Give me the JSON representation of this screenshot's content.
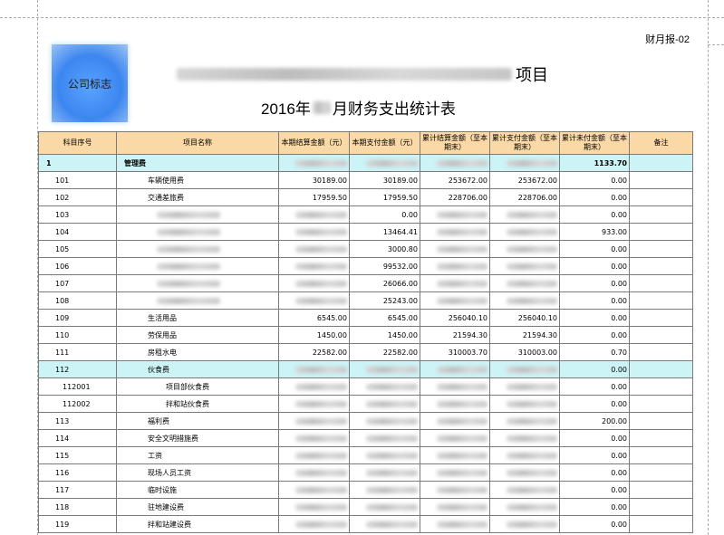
{
  "report_code": "财月报-02",
  "logo_text": "公司标志",
  "title_suffix": "项目",
  "subtitle": {
    "prefix": "2016年",
    "suffix": "月财务支出统计表"
  },
  "columns": [
    "科目序号",
    "项目名称",
    "本期结算金额（元）",
    "本期支付金额（元）",
    "累计结算金额（至本期末）",
    "累计支付金额（至本期末）",
    "累计未付金额（至本期末）",
    "备注"
  ],
  "rows": [
    {
      "code": "1",
      "name": "管理费",
      "c1": "",
      "c2": "",
      "c3": "",
      "c4": "",
      "c5": "1133.70",
      "style": "hl1",
      "indent": 0
    },
    {
      "code": "101",
      "name": "车辆使用费",
      "c1": "30189.00",
      "c2": "30189.00",
      "c3": "253672.00",
      "c4": "253672.00",
      "c5": "0.00",
      "indent": 1
    },
    {
      "code": "102",
      "name": "交通差旅费",
      "c1": "17959.50",
      "c2": "17959.50",
      "c3": "228706.00",
      "c4": "228706.00",
      "c5": "0.00",
      "indent": 1
    },
    {
      "code": "103",
      "name": "",
      "c1": "",
      "c2": "0.00",
      "c3": "",
      "c4": "",
      "c5": "0.00",
      "indent": 1
    },
    {
      "code": "104",
      "name": "",
      "c1": "",
      "c2": "13464.41",
      "c3": "",
      "c4": "",
      "c5": "933.00",
      "indent": 1
    },
    {
      "code": "105",
      "name": "",
      "c1": "",
      "c2": "3000.80",
      "c3": "",
      "c4": "",
      "c5": "0.00",
      "indent": 1
    },
    {
      "code": "106",
      "name": "",
      "c1": "",
      "c2": "99532.00",
      "c3": "",
      "c4": "",
      "c5": "0.00",
      "indent": 1
    },
    {
      "code": "107",
      "name": "",
      "c1": "",
      "c2": "26066.00",
      "c3": "",
      "c4": "",
      "c5": "0.00",
      "indent": 1
    },
    {
      "code": "108",
      "name": "",
      "c1": "",
      "c2": "25243.00",
      "c3": "",
      "c4": "",
      "c5": "0.00",
      "indent": 1
    },
    {
      "code": "109",
      "name": "生活用品",
      "c1": "6545.00",
      "c2": "6545.00",
      "c3": "256040.10",
      "c4": "256040.10",
      "c5": "0.00",
      "indent": 1
    },
    {
      "code": "110",
      "name": "劳保用品",
      "c1": "1450.00",
      "c2": "1450.00",
      "c3": "21594.30",
      "c4": "21594.30",
      "c5": "0.00",
      "indent": 1
    },
    {
      "code": "111",
      "name": "房租水电",
      "c1": "22582.00",
      "c2": "22582.00",
      "c3": "310003.70",
      "c4": "310003.00",
      "c5": "0.70",
      "indent": 1
    },
    {
      "code": "112",
      "name": "伙食费",
      "c1": "",
      "c2": "",
      "c3": "",
      "c4": "",
      "c5": "0.00",
      "style": "hl",
      "indent": 1
    },
    {
      "code": "112001",
      "name": "项目部伙食费",
      "c1": "",
      "c2": "",
      "c3": "",
      "c4": "",
      "c5": "0.00",
      "indent": 2
    },
    {
      "code": "112002",
      "name": "拌和站伙食费",
      "c1": "",
      "c2": "",
      "c3": "",
      "c4": "",
      "c5": "0.00",
      "indent": 2
    },
    {
      "code": "113",
      "name": "福利费",
      "c1": "",
      "c2": "",
      "c3": "",
      "c4": "",
      "c5": "200.00",
      "indent": 1
    },
    {
      "code": "114",
      "name": "安全文明措施费",
      "c1": "",
      "c2": "",
      "c3": "",
      "c4": "",
      "c5": "0.00",
      "indent": 1
    },
    {
      "code": "115",
      "name": "工资",
      "c1": "",
      "c2": "",
      "c3": "",
      "c4": "",
      "c5": "0.00",
      "indent": 1
    },
    {
      "code": "116",
      "name": "现场人员工资",
      "c1": "",
      "c2": "",
      "c3": "",
      "c4": "",
      "c5": "0.00",
      "indent": 1
    },
    {
      "code": "117",
      "name": "临时设施",
      "c1": "",
      "c2": "",
      "c3": "",
      "c4": "",
      "c5": "0.00",
      "indent": 1
    },
    {
      "code": "118",
      "name": "驻地建设费",
      "c1": "",
      "c2": "",
      "c3": "",
      "c4": "",
      "c5": "0.00",
      "indent": 1
    },
    {
      "code": "119",
      "name": "拌和站建设费",
      "c1": "",
      "c2": "",
      "c3": "",
      "c4": "",
      "c5": "0.00",
      "indent": 1
    }
  ],
  "colors": {
    "header_bg": "#fbd9a6",
    "highlight_bg": "#ccf3f6",
    "logo_blue": "#3c86f0"
  }
}
